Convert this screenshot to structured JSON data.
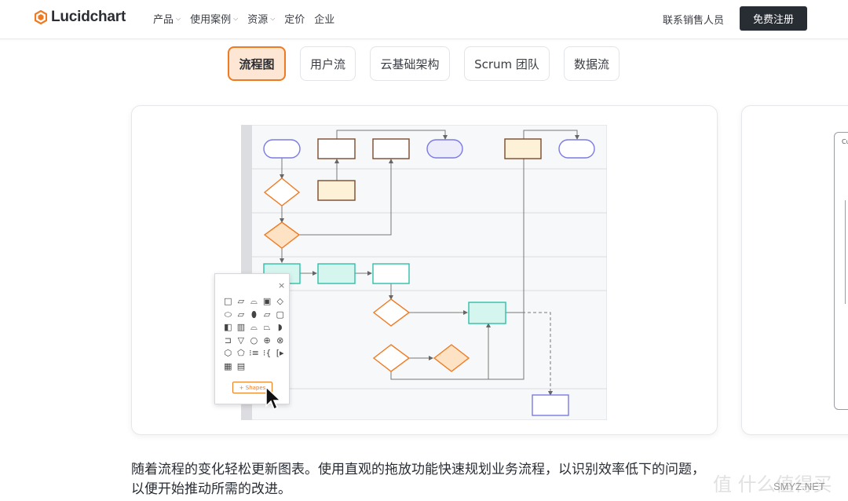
{
  "brand": {
    "name": "Lucidchart",
    "accent": "#f07a22",
    "dark": "#282c33"
  },
  "nav": {
    "items": [
      {
        "label": "产品",
        "dropdown": true
      },
      {
        "label": "使用案例",
        "dropdown": true
      },
      {
        "label": "资源",
        "dropdown": true
      },
      {
        "label": "定价",
        "dropdown": false
      },
      {
        "label": "企业",
        "dropdown": false
      }
    ],
    "sales": "联系销售人员",
    "signup": "免费注册"
  },
  "tabs": [
    {
      "label": "流程图",
      "active": true
    },
    {
      "label": "用户流",
      "active": false
    },
    {
      "label": "云基础架构",
      "active": false
    },
    {
      "label": "Scrum 团队",
      "active": false
    },
    {
      "label": "数据流",
      "active": false
    }
  ],
  "panel": {
    "close": "×",
    "shapes_button": "+ Shapes",
    "icons": [
      "□",
      "▱",
      "⌓",
      "▣",
      "◇",
      "⬭",
      "⏥",
      "⬮",
      "▱",
      "▢",
      "◧",
      "▥",
      "⌓",
      "⏢",
      "◗",
      "⊐",
      "▽",
      "○",
      "⊕",
      "⊗",
      "⬡",
      "⬠",
      "⁝≡",
      "⁝{",
      "[▸",
      "▦",
      "▤"
    ]
  },
  "card2": {
    "label": "Cu"
  },
  "description": "随着流程的变化轻松更新图表。使用直观的拖放功能快速规划业务流程，以识别效率低下的问题，以便开始推动所需的改进。",
  "watermark": {
    "text": "SMYZ.NET",
    "overlay": "值 什么值得买"
  },
  "colors": {
    "purple_stroke": "#7b7be0",
    "purple_fill": "#ececfb",
    "brown_stroke": "#7a4a2e",
    "cream_fill": "#fdf1d8",
    "orange_stroke": "#f07a22",
    "orange_fill": "#fde3c4",
    "teal_stroke": "#2fbfa8",
    "teal_fill": "#d4f6ef"
  }
}
